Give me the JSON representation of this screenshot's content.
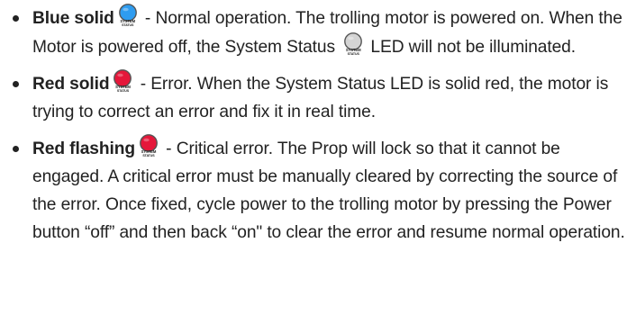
{
  "items": [
    {
      "term": "Blue solid",
      "led_icon": "led-blue-icon",
      "led_color": "#2e9cf0",
      "led_label_line1": "SYSTEM",
      "led_label_line2": "STATUS",
      "desc_before": " - Normal operation. The trolling motor is powered on. When the Motor is powered off, the System Status ",
      "off_led_icon": "led-off-icon",
      "off_led_color": "#d4d4d4",
      "desc_after": " LED will not be illuminated."
    },
    {
      "term": "Red solid",
      "led_icon": "led-red-icon",
      "led_color": "#e5173a",
      "led_label_line1": "SYSTEM",
      "led_label_line2": "STATUS",
      "desc": " - Error. When the System Status LED is solid red, the motor is trying to correct an error and fix it in real time."
    },
    {
      "term": "Red flashing",
      "led_icon": "led-red-flashing-icon",
      "led_color": "#e5173a",
      "led_label_line1": "SYSTEM",
      "led_label_line2": "STATUS",
      "desc": " - Critical error. The Prop will lock so that it cannot be engaged. A critical error must be manually cleared by correcting the source of the error. Once fixed, cycle power to the trolling motor by pressing the Power button “off” and then back “on\" to clear the error and resume normal operation."
    }
  ]
}
